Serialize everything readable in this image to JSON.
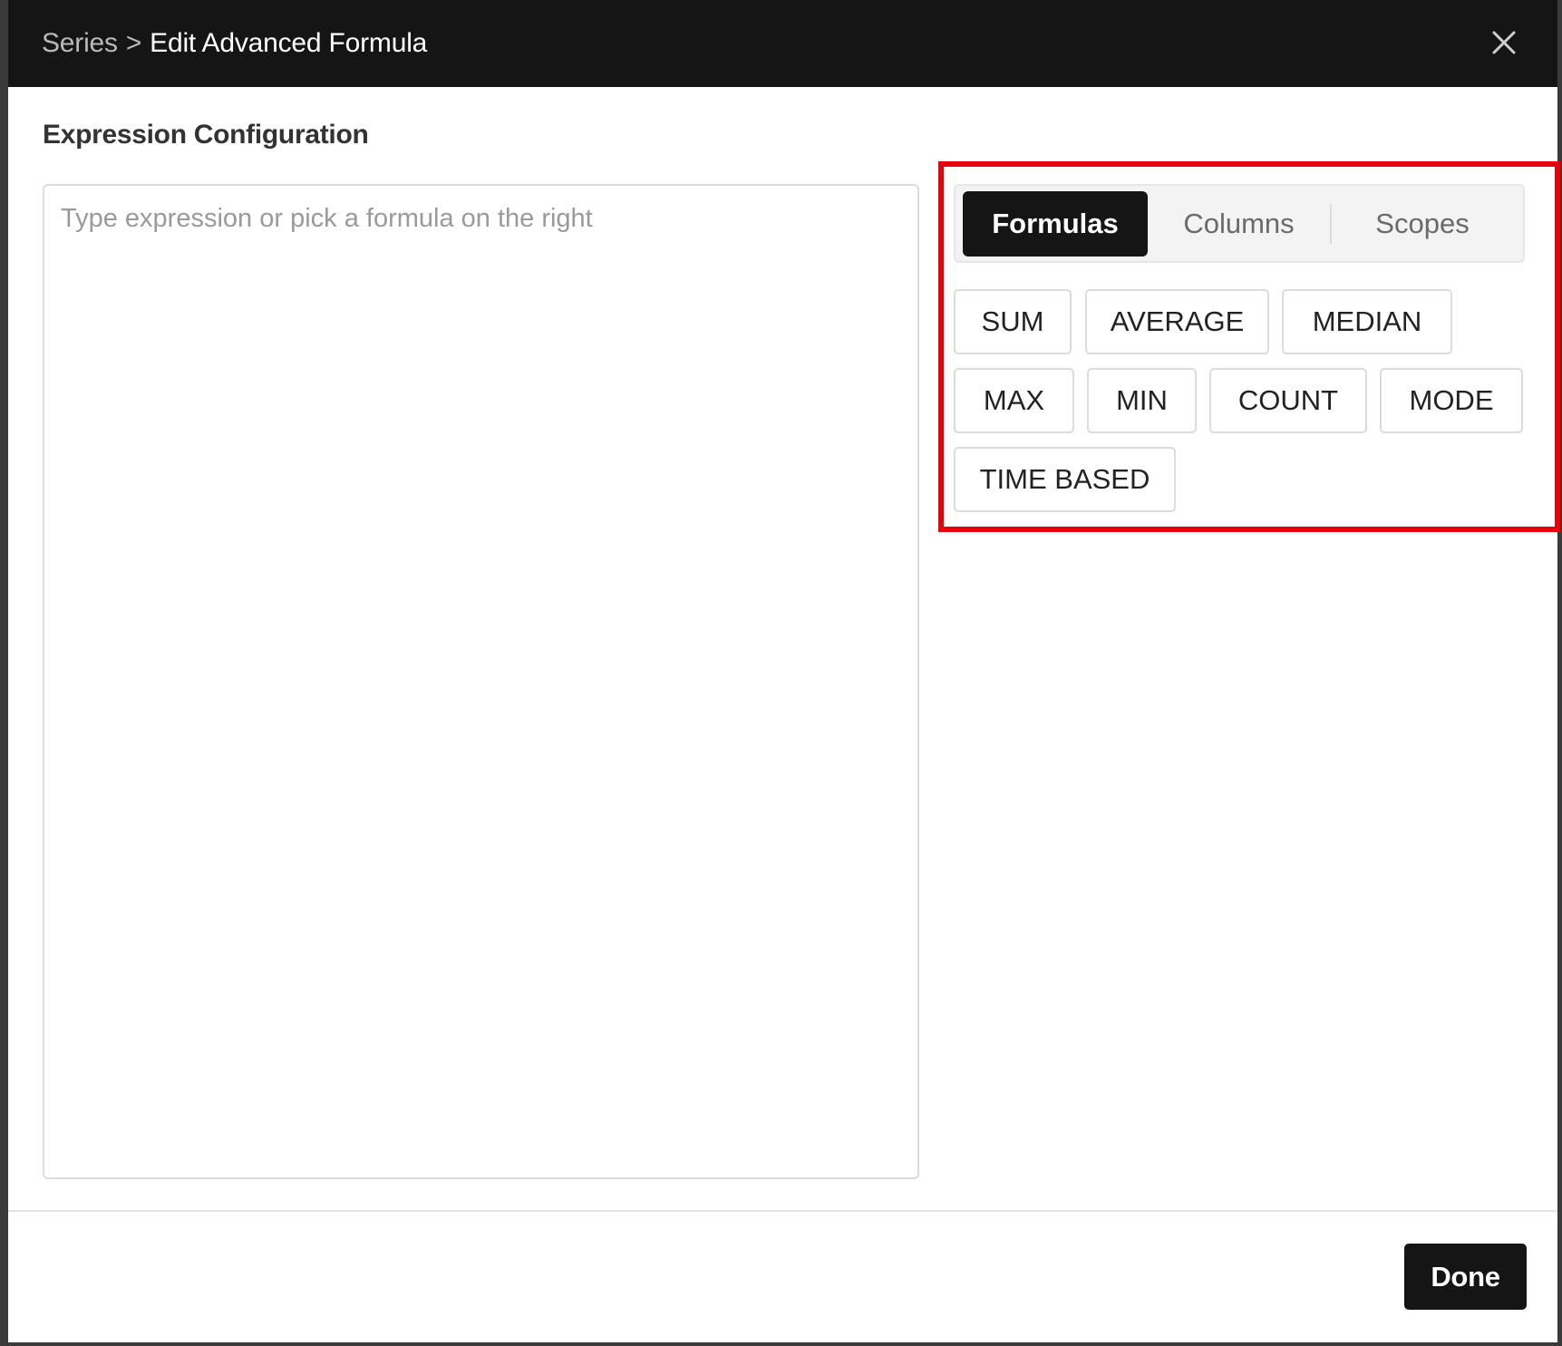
{
  "dialog": {
    "breadcrumb_parent": "Series",
    "breadcrumb_separator": ">",
    "breadcrumb_current": "Edit Advanced Formula",
    "close_icon": "close-icon"
  },
  "expression": {
    "section_title": "Expression Configuration",
    "value": "",
    "placeholder": "Type expression or pick a formula on the right"
  },
  "picker": {
    "tabs": [
      {
        "label": "Formulas",
        "active": true
      },
      {
        "label": "Columns",
        "active": false
      },
      {
        "label": "Scopes",
        "active": false
      }
    ],
    "formulas": [
      "SUM",
      "AVERAGE",
      "MEDIAN",
      "MAX",
      "MIN",
      "COUNT",
      "MODE",
      "TIME BASED"
    ]
  },
  "footer": {
    "done_label": "Done"
  },
  "colors": {
    "titlebar": "#151515",
    "highlight": "#e8000b",
    "active_tab": "#151515"
  }
}
